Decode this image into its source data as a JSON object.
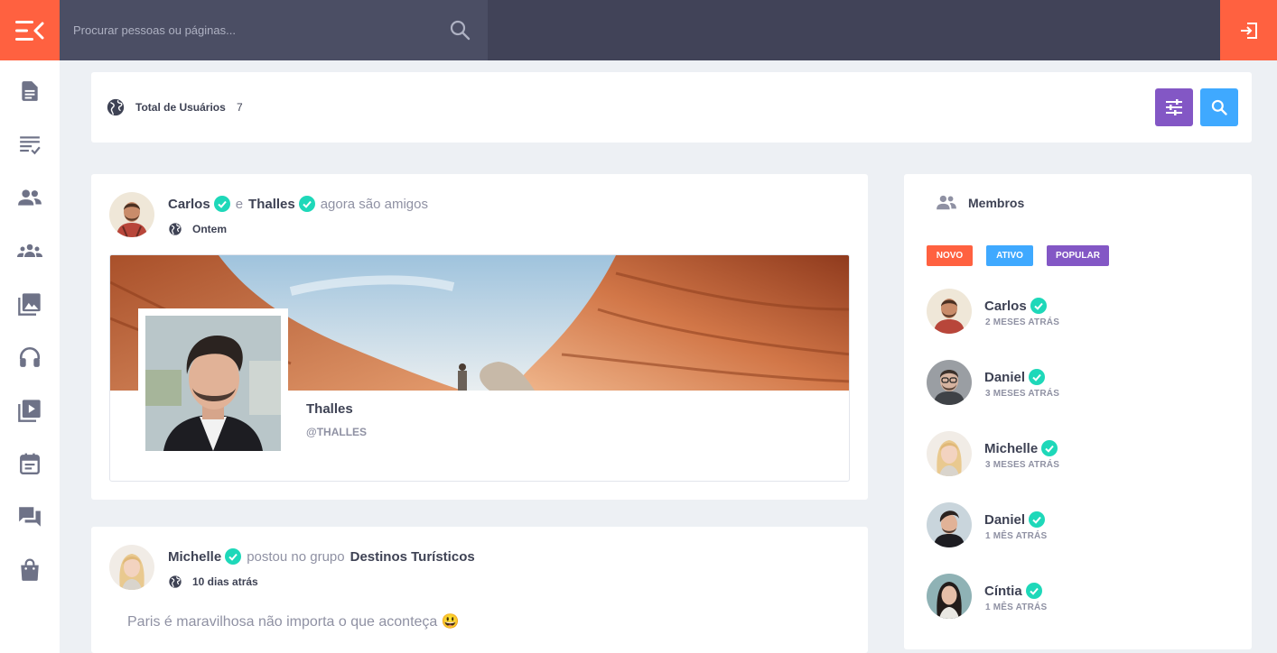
{
  "search": {
    "placeholder": "Procurar pessoas ou páginas..."
  },
  "sidebar": {
    "items": [
      {
        "icon": "document-icon"
      },
      {
        "icon": "checklist-icon"
      },
      {
        "icon": "friends-icon"
      },
      {
        "icon": "groups-icon"
      },
      {
        "icon": "photos-icon"
      },
      {
        "icon": "headphones-icon"
      },
      {
        "icon": "video-playlist-icon"
      },
      {
        "icon": "calendar-icon"
      },
      {
        "icon": "forum-icon"
      },
      {
        "icon": "shopping-bag-icon"
      }
    ]
  },
  "header": {
    "total_label": "Total de Usuários",
    "total_value": "7"
  },
  "posts": [
    {
      "actor": "Carlos",
      "connector": "e",
      "target": "Thalles",
      "action": "agora são amigos",
      "time": "Ontem",
      "profile": {
        "name": "Thalles",
        "handle": "@THALLES"
      }
    },
    {
      "actor": "Michelle",
      "action": "postou no grupo",
      "group": "Destinos Turísticos",
      "time": "10 dias atrás",
      "text": "Paris é maravilhosa não importa o que aconteça 😃"
    }
  ],
  "members": {
    "title": "Membros",
    "filters": [
      "NOVO",
      "ATIVO",
      "POPULAR"
    ],
    "list": [
      {
        "name": "Carlos",
        "time": "2 MESES ATRÁS"
      },
      {
        "name": "Daniel",
        "time": "3 MESES ATRÁS"
      },
      {
        "name": "Michelle",
        "time": "3 MESES ATRÁS"
      },
      {
        "name": "Daniel",
        "time": "1 MÊS ATRÁS"
      },
      {
        "name": "Cíntia",
        "time": "1 MÊS ATRÁS"
      }
    ]
  },
  "colors": {
    "accent_orange": "#ff6140",
    "topbar": "#414358",
    "purple": "#8357c5",
    "blue": "#3fa9ff",
    "verified": "#1ed8b9"
  }
}
